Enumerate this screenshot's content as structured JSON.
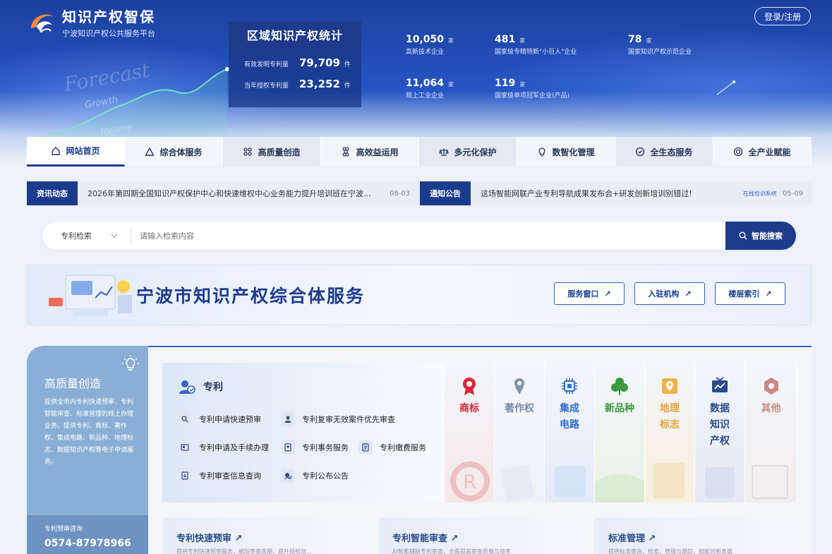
{
  "brand": {
    "title": "知识产权智保",
    "subtitle": "宁波知识产权公共服务平台"
  },
  "header": {
    "login_label": "登录/注册",
    "deco_forecast": "Forecast",
    "deco_growth": "Growth",
    "deco_income": "Income"
  },
  "regional_stats": {
    "title": "区域知识产权统计",
    "rows": [
      {
        "label": "有效发明专利量",
        "value": "79,709",
        "unit": "件"
      },
      {
        "label": "当年授权专利量",
        "value": "23,252",
        "unit": "件"
      }
    ]
  },
  "metrics": [
    {
      "value": "10,050",
      "unit": "家",
      "label": "高新技术企业"
    },
    {
      "value": "481",
      "unit": "家",
      "label": "国家级专精特新\"小巨人\"企业"
    },
    {
      "value": "78",
      "unit": "家",
      "label": "国家知识产权示范企业"
    },
    {
      "value": "11,064",
      "unit": "家",
      "label": "规上工业企业"
    },
    {
      "value": "119",
      "unit": "家",
      "label": "国家级单项冠军企业(产品)"
    }
  ],
  "nav": [
    {
      "label": "网站首页",
      "icon": "home-icon"
    },
    {
      "label": "综合体服务",
      "icon": "triangle-warning-icon"
    },
    {
      "label": "高质量创造",
      "icon": "grid-dots-icon"
    },
    {
      "label": "高效益运用",
      "icon": "command-icon"
    },
    {
      "label": "多元化保护",
      "icon": "scale-icon"
    },
    {
      "label": "数智化管理",
      "icon": "bulb-icon"
    },
    {
      "label": "全生态服务",
      "icon": "check-circle-icon"
    },
    {
      "label": "全产业赋能",
      "icon": "target-icon"
    }
  ],
  "news": {
    "tag1": "资讯动态",
    "item1_text": "2026年第四期全国知识产权保护中心和快速维权中心业务能力提升培训班在宁波...",
    "item1_date": "08-03",
    "tag2": "通知公告",
    "item2_text": "这场智能网联产业专利导航成果发布会+研发创新培训别错过!",
    "item2_source": "在线培训系统",
    "item2_date": "05-09"
  },
  "search": {
    "type_label": "专利检索",
    "placeholder": "请输入检索内容",
    "button_label": "智能搜索"
  },
  "banner": {
    "title": "宁波市知识产权综合体服务",
    "buttons": [
      "服务窗口",
      "入驻机构",
      "楼层索引"
    ]
  },
  "side_card": {
    "title": "高质量创造",
    "description": "提供全市内专利快速预审、专利智能审查、标准管理的线上办理业务，提供专利、商标、著作权、集成电路、新品种、地理标志、数据知识产权等电子申请服务。",
    "consult_label": "专利预审咨询",
    "phone": "0574-87978966"
  },
  "patent": {
    "title": "专利",
    "items": [
      "专利申请快速预审",
      "专利复审无效案件优先审查",
      "专利申请及手续办理",
      "专利事务服务",
      "专利缴费服务",
      "专利审查信息查询",
      "专利公布公告"
    ]
  },
  "categories": [
    {
      "label": "商标",
      "color": "#d9253a",
      "icon": "trademark-ribbon-icon"
    },
    {
      "label": "著作权",
      "color": "#7a8aa8",
      "icon": "copyright-pin-icon"
    },
    {
      "label": "集成电路",
      "color": "#2f6fd0",
      "icon": "chip-icon"
    },
    {
      "label": "新品种",
      "color": "#3a9a3e",
      "icon": "clover-icon"
    },
    {
      "label": "地理标志",
      "color": "#e8a23a",
      "icon": "map-pin-icon"
    },
    {
      "label": "数据知识产权",
      "color": "#2b4a8a",
      "icon": "data-screen-icon"
    },
    {
      "label": "其他",
      "color": "#c98a86",
      "icon": "hexagon-icon"
    }
  ],
  "sub_cards": [
    {
      "title": "专利快速预审",
      "desc": "提供专利快速预审服务，缩短审查周期，提升授权效..."
    },
    {
      "title": "专利智能审查",
      "desc": "AI智能辅助专利审查，全面提高审查质量与效率"
    },
    {
      "title": "标准管理",
      "desc": "提供标准查询、检索、管理与跟踪，赋能创新发展"
    }
  ],
  "colors": {
    "primary": "#1d3b8c",
    "header_blue": "#2555c4",
    "accent": "#3a63c4"
  }
}
